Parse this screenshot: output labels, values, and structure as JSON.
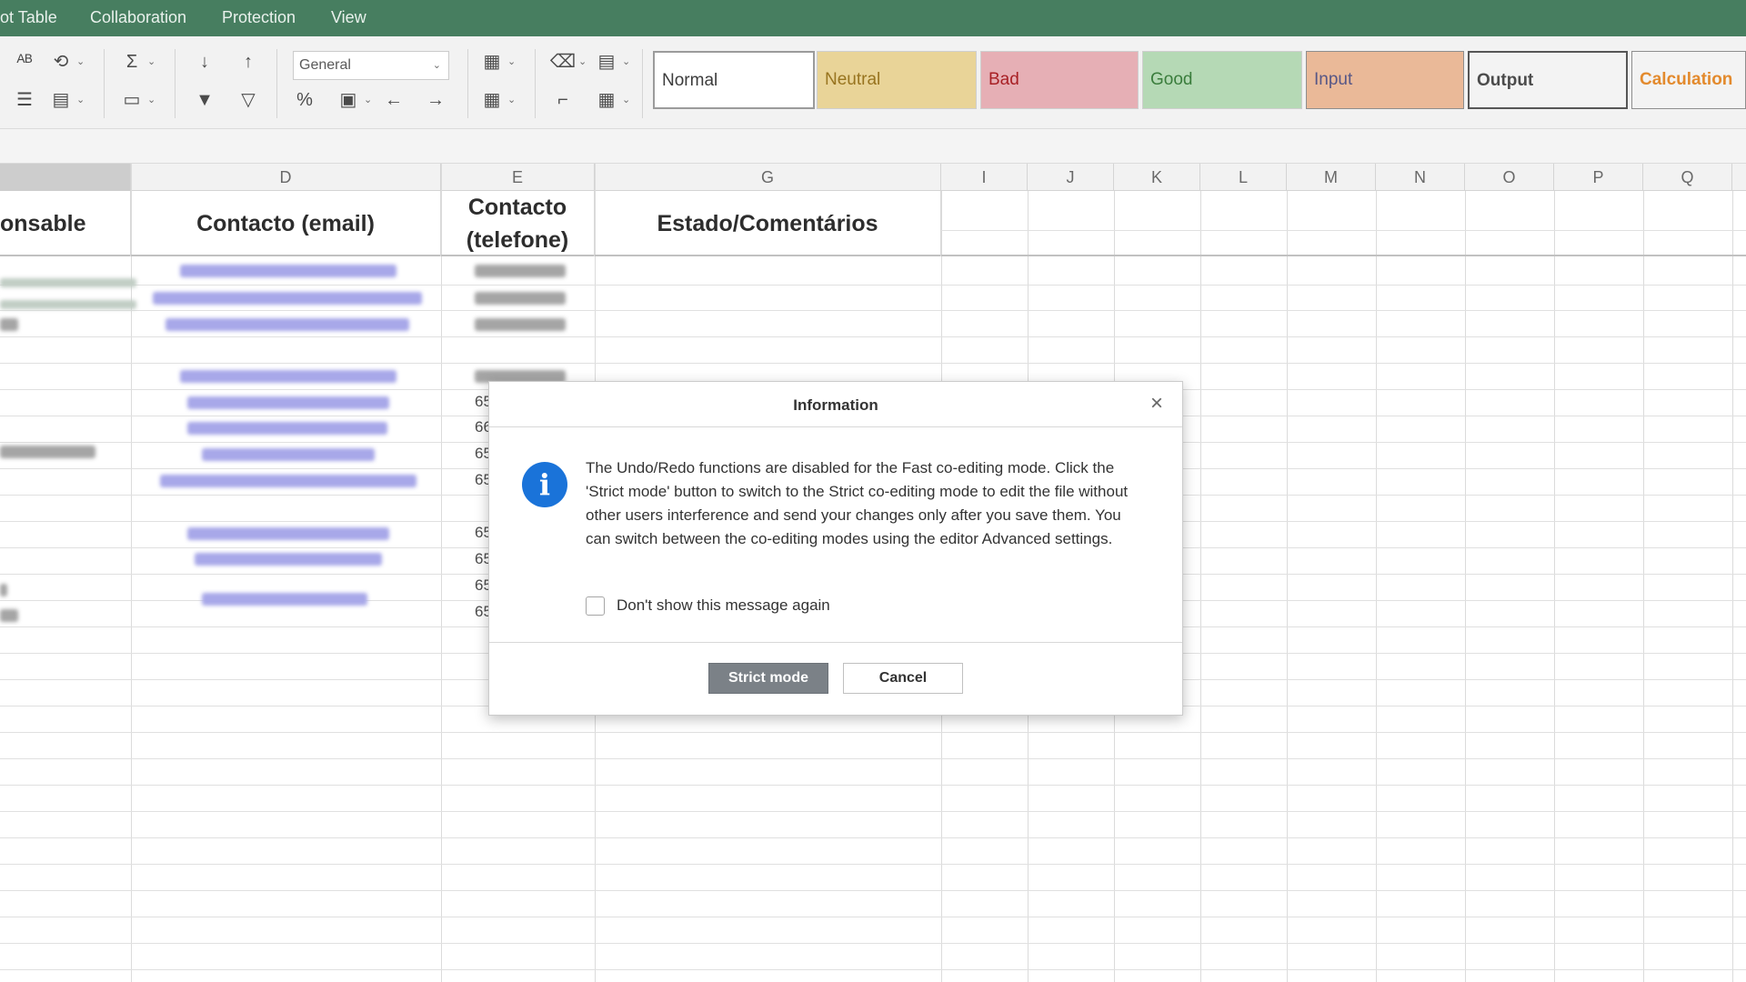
{
  "menu": {
    "items": [
      "ot Table",
      "Collaboration",
      "Protection",
      "View"
    ]
  },
  "toolbar": {
    "number_format": "General",
    "cell_styles": [
      {
        "label": "Normal",
        "bg": "#ffffff",
        "color": "#222222"
      },
      {
        "label": "Neutral",
        "bg": "#e6cf8a",
        "color": "#8a6100"
      },
      {
        "label": "Bad",
        "bg": "#e3a4ab",
        "color": "#9c0006"
      },
      {
        "label": "Good",
        "bg": "#abd4ab",
        "color": "#1f6b22"
      },
      {
        "label": "Input",
        "bg": "#e7b08a",
        "color": "#3f3f76"
      },
      {
        "label": "Output",
        "bg": "#f2f2f2",
        "color": "#333333"
      },
      {
        "label": "Calculation",
        "bg": "#f2f2f2",
        "color": "#e07a10"
      }
    ]
  },
  "sheet": {
    "columns": [
      "D",
      "E",
      "G",
      "I",
      "J",
      "K",
      "L",
      "M",
      "N",
      "O",
      "P",
      "Q"
    ],
    "header_row": {
      "c": "onsable",
      "d": "Contacto (email)",
      "e_line1": "Contacto",
      "e_line2": "(telefone)",
      "g": "Estado/Comentários"
    },
    "partial_digits": [
      "65",
      "66",
      "65",
      "65",
      "65",
      "65",
      "65",
      "65"
    ]
  },
  "dialog": {
    "title": "Information",
    "message": "The Undo/Redo functions are disabled for the Fast co-editing mode. Click the 'Strict mode' button to switch to the Strict co-editing mode to edit the file without other users interference and send your changes only after you save them. You can switch between the co-editing modes using the editor Advanced settings.",
    "checkbox_label": "Don't show this message again",
    "primary_button": "Strict mode",
    "secondary_button": "Cancel"
  },
  "colors": {
    "menubar": "#2e6d4b",
    "info_icon": "#1a73d9",
    "primary_button": "#7b8187"
  }
}
